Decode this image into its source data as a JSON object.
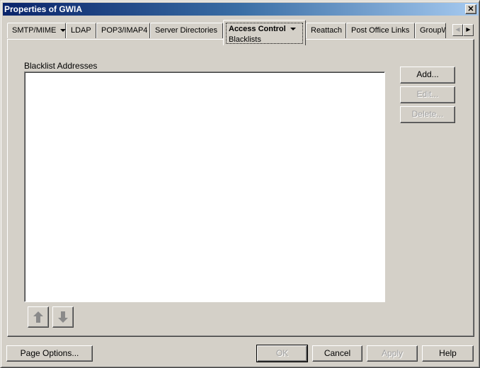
{
  "window": {
    "title": "Properties of GWIA",
    "close_icon": "close-icon"
  },
  "tabs": [
    {
      "label": "SMTP/MIME",
      "has_dropdown": true
    },
    {
      "label": "LDAP",
      "has_dropdown": false
    },
    {
      "label": "POP3/IMAP4",
      "has_dropdown": false
    },
    {
      "label": "Server Directories",
      "has_dropdown": false
    },
    {
      "label": "Access Control",
      "has_dropdown": true,
      "active": true,
      "subpage": "Blacklists"
    },
    {
      "label": "Reattach",
      "has_dropdown": false
    },
    {
      "label": "Post Office Links",
      "has_dropdown": false
    },
    {
      "label": "GroupW",
      "has_dropdown": false
    }
  ],
  "tab_scroll": {
    "left_icon": "chevron-left-icon",
    "right_icon": "chevron-right-icon"
  },
  "panel": {
    "list_label": "Blacklist Addresses",
    "list_items": [],
    "buttons": {
      "add": "Add...",
      "edit": "Edit...",
      "delete": "Delete..."
    },
    "move_up_icon": "arrow-up-icon",
    "move_down_icon": "arrow-down-icon"
  },
  "footer": {
    "page_options": "Page Options...",
    "ok": "OK",
    "cancel": "Cancel",
    "apply": "Apply",
    "help": "Help"
  }
}
